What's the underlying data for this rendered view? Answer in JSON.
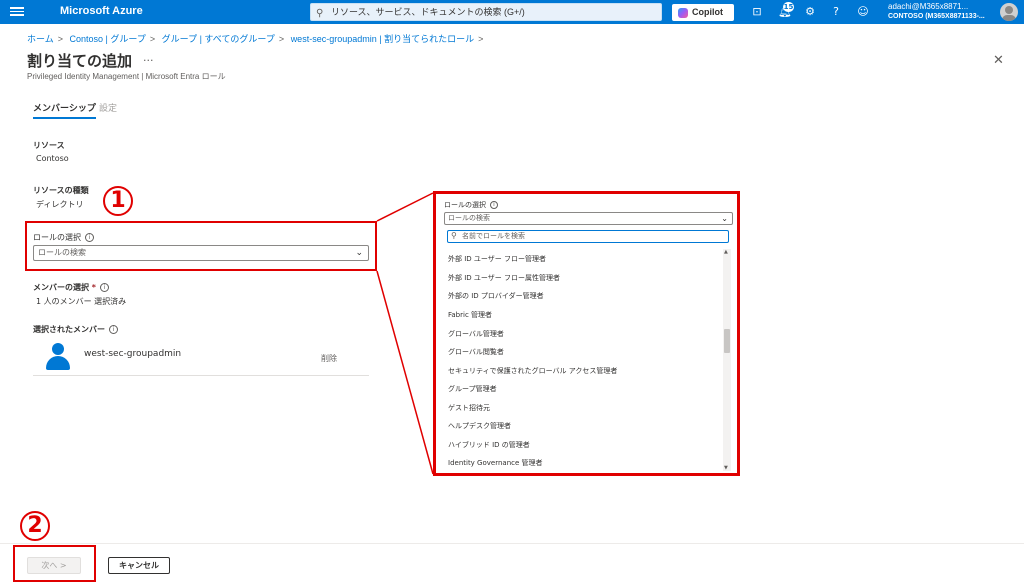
{
  "topbar": {
    "brand": "Microsoft Azure",
    "search_placeholder": "リソース、サービス、ドキュメントの検索 (G+/)",
    "copilot_label": "Copilot",
    "notification_count": "15",
    "user_email": "adachi@M365x8871...",
    "user_tenant": "CONTOSO (M365X8871133-..."
  },
  "breadcrumb": [
    "ホーム",
    "Contoso | グループ",
    "グループ | すべてのグループ",
    "west-sec-groupadmin | 割り当てられたロール"
  ],
  "page": {
    "title": "割り当ての追加",
    "more": "···",
    "subtitle": "Privileged Identity Management | Microsoft Entra ロール"
  },
  "tabs": {
    "membership": "メンバーシップ",
    "settings": "設定"
  },
  "form": {
    "resource_label": "リソース",
    "resource_value": "Contoso",
    "resource_type_label": "リソースの種類",
    "resource_type_value": "ディレクトリ",
    "role_select_label": "ロールの選択",
    "role_select_placeholder": "ロールの検索",
    "member_select_label": "メンバーの選択",
    "required_mark": "*",
    "member_select_value": "1 人のメンバー 選択済み",
    "selected_members_label": "選択されたメンバー",
    "member_name": "west-sec-groupadmin",
    "remove_label": "削除"
  },
  "annotations": {
    "one": "1",
    "two": "2"
  },
  "zoom": {
    "label": "ロールの選択",
    "placeholder": "ロールの検索",
    "search_placeholder": "名前でロールを検索",
    "items": [
      "外部 ID ユーザー フロー管理者",
      "外部 ID ユーザー フロー属性管理者",
      "外部の ID プロバイダー管理者",
      "Fabric 管理者",
      "グローバル管理者",
      "グローバル閲覧者",
      "セキュリティで保護されたグローバル アクセス管理者",
      "グループ管理者",
      "ゲスト招待元",
      "ヘルプデスク管理者",
      "ハイブリッド ID の管理者",
      "Identity Governance 管理者"
    ]
  },
  "footer": {
    "next": "次へ >",
    "cancel": "キャンセル"
  }
}
